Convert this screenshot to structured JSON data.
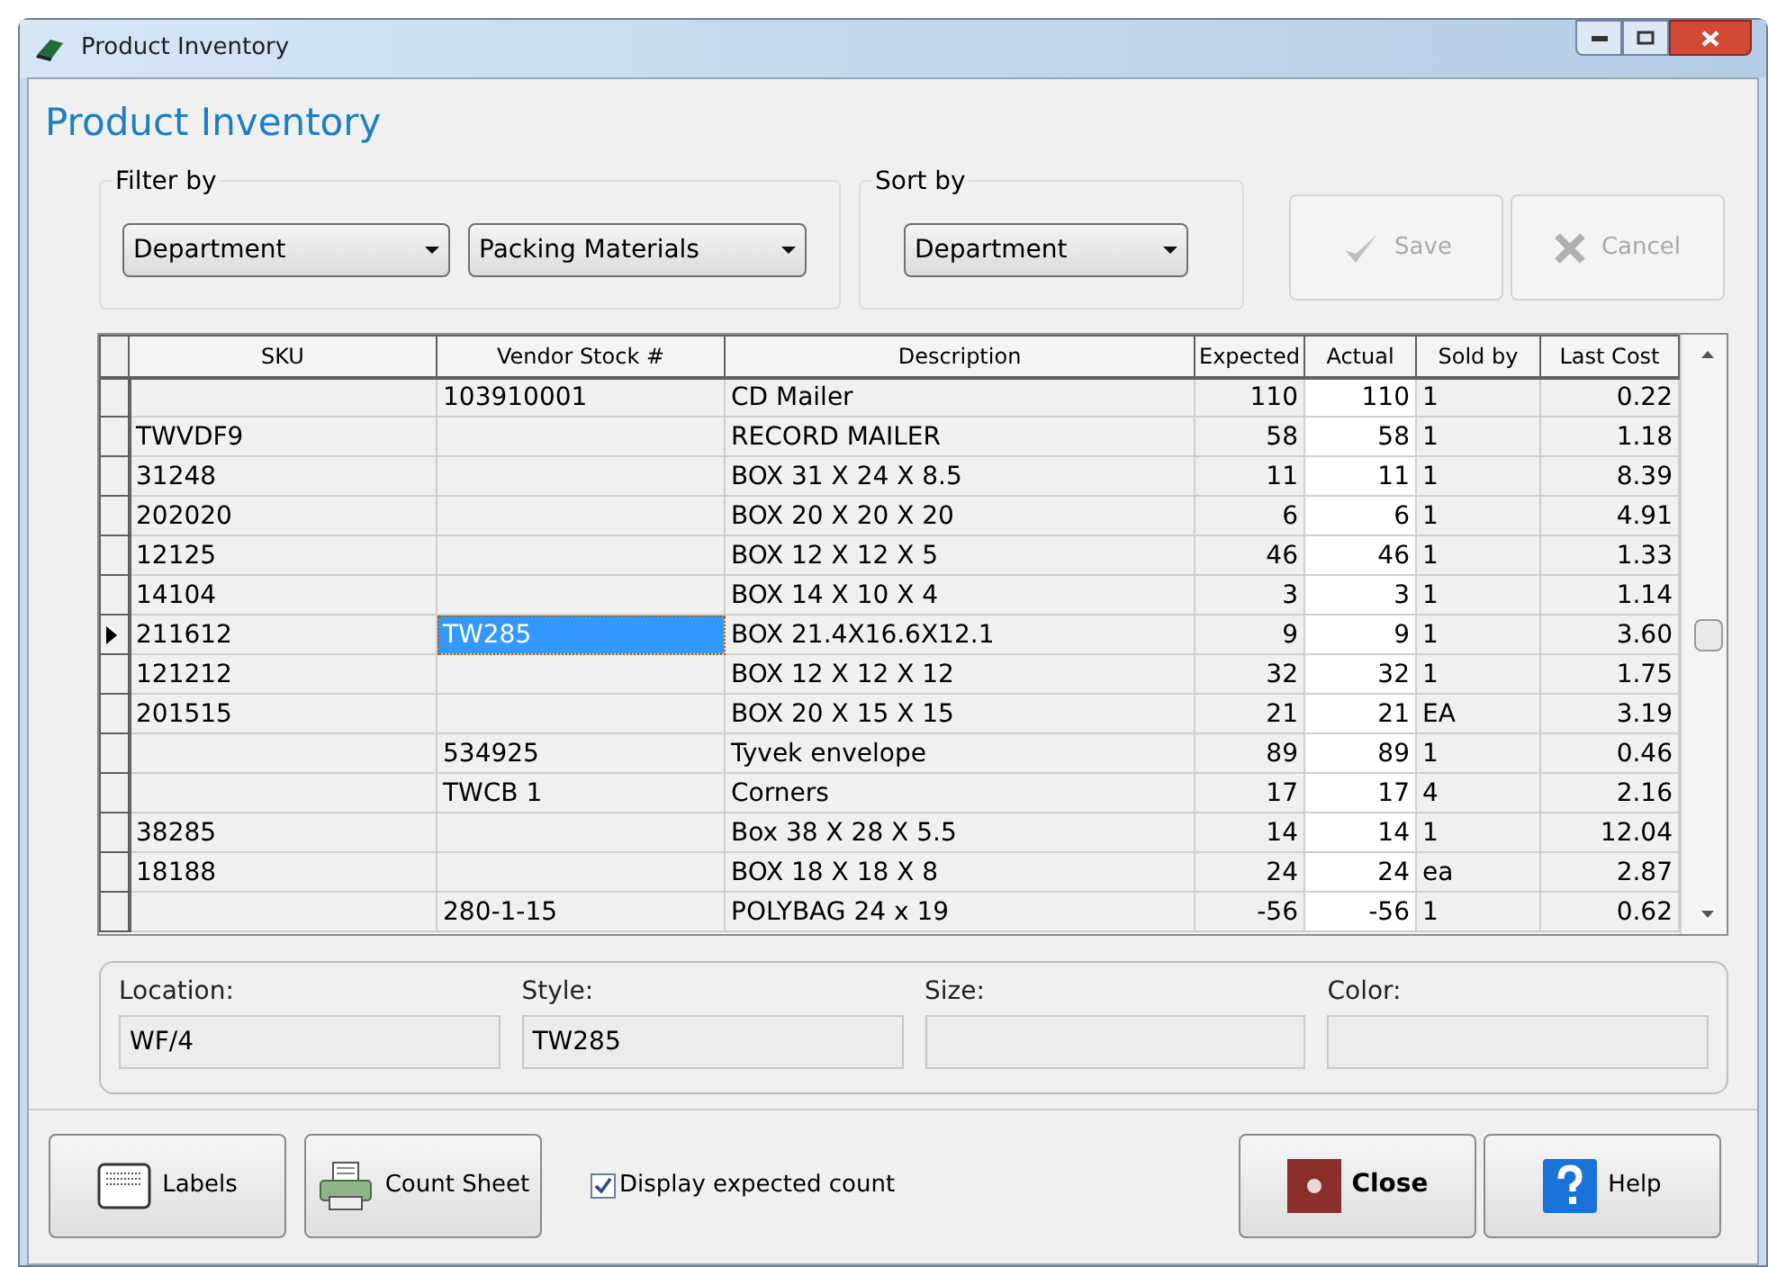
{
  "window": {
    "title": "Product Inventory"
  },
  "heading": "Product Inventory",
  "filter": {
    "label": "Filter by",
    "field": "Department",
    "value": "Packing Materials"
  },
  "sort": {
    "label": "Sort by",
    "value": "Department"
  },
  "actions": [
    {
      "kind": "save",
      "label": "Save",
      "disabled": true
    },
    {
      "kind": "cancel",
      "label": "Cancel",
      "disabled": true
    }
  ],
  "grid": {
    "columns": [
      "SKU",
      "Vendor Stock #",
      "Description",
      "Expected",
      "Actual",
      "Sold by",
      "Last Cost"
    ],
    "rows": [
      {
        "vendor": "103910001",
        "description": "CD Mailer",
        "expected": "110",
        "actual": "110",
        "sold_by": "1",
        "last_cost": "0.22",
        "selected": false
      },
      {
        "sku": "TWVDF9",
        "description": "RECORD MAILER",
        "expected": "58",
        "actual": "58",
        "sold_by": "1",
        "last_cost": "1.18",
        "selected": false
      },
      {
        "sku": "31248",
        "description": "BOX 31 X 24 X 8.5",
        "expected": "11",
        "actual": "11",
        "sold_by": "1",
        "last_cost": "8.39",
        "selected": false
      },
      {
        "sku": "202020",
        "description": "BOX 20 X 20 X 20",
        "expected": "6",
        "actual": "6",
        "sold_by": "1",
        "last_cost": "4.91",
        "selected": false
      },
      {
        "sku": "12125",
        "description": "BOX 12 X 12 X 5",
        "expected": "46",
        "actual": "46",
        "sold_by": "1",
        "last_cost": "1.33",
        "selected": false
      },
      {
        "sku": "14104",
        "description": "BOX 14 X 10 X 4",
        "expected": "3",
        "actual": "3",
        "sold_by": "1",
        "last_cost": "1.14",
        "selected": false
      },
      {
        "sku": "211612",
        "vendor": "TW285",
        "description": "BOX 21.4X16.6X12.1",
        "expected": "9",
        "actual": "9",
        "sold_by": "1",
        "last_cost": "3.60",
        "selected": true,
        "vendor_focused": true
      },
      {
        "sku": "121212",
        "description": "BOX 12 X 12 X 12",
        "expected": "32",
        "actual": "32",
        "sold_by": "1",
        "last_cost": "1.75",
        "selected": false
      },
      {
        "sku": "201515",
        "description": "BOX 20 X 15  X 15",
        "expected": "21",
        "actual": "21",
        "sold_by": "EA",
        "last_cost": "3.19",
        "selected": false
      },
      {
        "vendor": "534925",
        "description": "Tyvek envelope",
        "expected": "89",
        "actual": "89",
        "sold_by": "1",
        "last_cost": "0.46",
        "selected": false
      },
      {
        "vendor": "TWCB 1",
        "description": "Corners",
        "expected": "17",
        "actual": "17",
        "sold_by": "4",
        "last_cost": "2.16",
        "selected": false
      },
      {
        "sku": "38285",
        "description": "Box 38 X 28 X 5.5",
        "expected": "14",
        "actual": "14",
        "sold_by": "1",
        "last_cost": "12.04",
        "selected": false
      },
      {
        "sku": "18188",
        "description": "BOX 18 X 18 X 8",
        "expected": "24",
        "actual": "24",
        "sold_by": "ea",
        "last_cost": "2.87",
        "selected": false
      },
      {
        "vendor": "280-1-15",
        "description": "POLYBAG 24 x 19",
        "expected": "-56",
        "actual": "-56",
        "sold_by": "1",
        "last_cost": "0.62",
        "selected": false
      }
    ]
  },
  "details": [
    {
      "label": "Location:",
      "value": "WF/4"
    },
    {
      "label": "Style:",
      "value": "TW285"
    },
    {
      "label": "Size:"
    },
    {
      "label": "Color:"
    }
  ],
  "footer": {
    "buttons": [
      {
        "kind": "labels",
        "label": "Labels"
      },
      {
        "kind": "count",
        "label": "Count Sheet"
      }
    ],
    "display_expected": {
      "label": "Display expected count",
      "checked": true
    },
    "right_buttons": [
      {
        "kind": "close",
        "label": "Close"
      },
      {
        "kind": "help",
        "label": "Help"
      }
    ]
  }
}
